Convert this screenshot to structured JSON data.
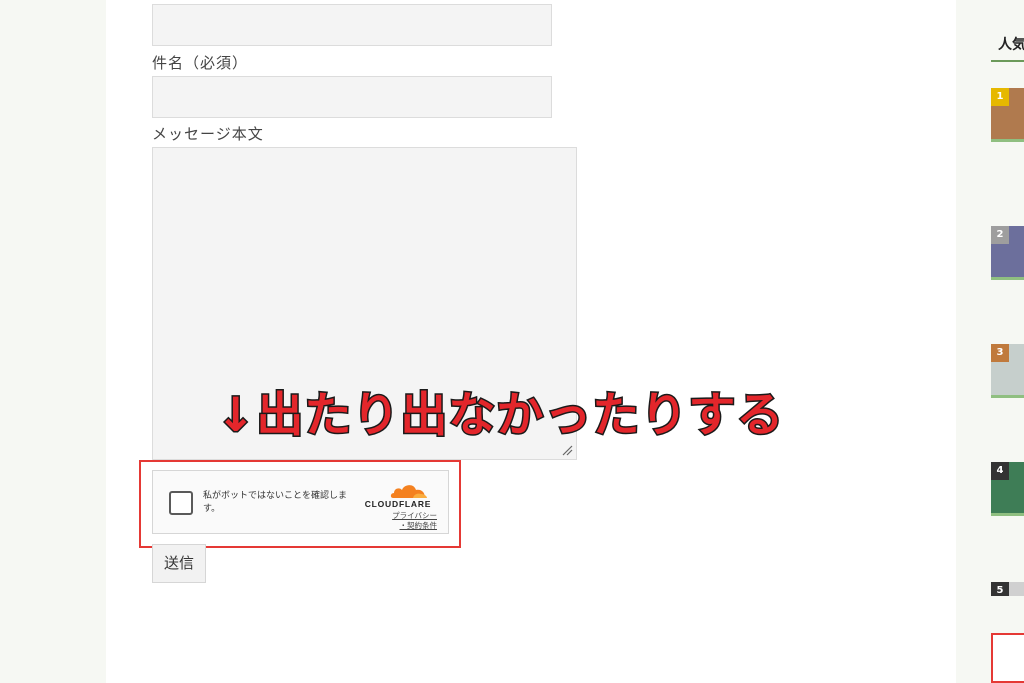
{
  "form": {
    "subject_label": "件名（必須）",
    "message_label": "メッセージ本文",
    "submit_label": "送信"
  },
  "turnstile": {
    "checkbox_text": "私がボットではないことを確認します。",
    "brand": "CLOUDFLARE",
    "privacy_link": "プライバシー",
    "terms_link": "・契約条件"
  },
  "annotation": {
    "text": "↓出たり出なかったりする",
    "color": "#e3262b"
  },
  "sidebar": {
    "title": "人気",
    "ranks": [
      {
        "num": "1",
        "badge_color": "#e6b800",
        "thumb_color": "#b07a4e"
      },
      {
        "num": "2",
        "badge_color": "#9e9e9e",
        "thumb_color": "#6c6f9c"
      },
      {
        "num": "3",
        "badge_color": "#c07a3c",
        "thumb_color": "#c6cfcc"
      },
      {
        "num": "4",
        "badge_color": "#333333",
        "thumb_color": "#3e7d56"
      },
      {
        "num": "5",
        "badge_color": "#333333",
        "thumb_color": "#d0d0d0"
      }
    ]
  }
}
